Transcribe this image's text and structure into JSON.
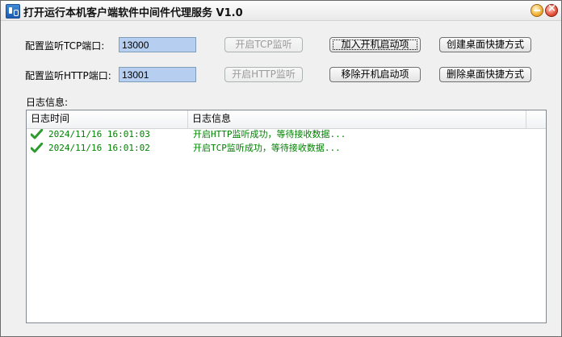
{
  "window": {
    "title": "打开运行本机客户端软件中间件代理服务 V1.0"
  },
  "config": {
    "tcp_label": "配置监听TCP端口:",
    "tcp_port": "13000",
    "http_label": "配置监听HTTP端口:",
    "http_port": "13001"
  },
  "buttons": {
    "start_tcp": "开启TCP监听",
    "start_http": "开启HTTP监听",
    "add_startup": "加入开机启动项",
    "remove_startup": "移除开机启动项",
    "create_shortcut": "创建桌面快捷方式",
    "delete_shortcut": "删除桌面快捷方式"
  },
  "log": {
    "section_label": "日志信息:",
    "columns": [
      "日志时间",
      "日志信息"
    ],
    "rows": [
      {
        "time": "2024/11/16 16:01:03",
        "message": "开启HTTP监听成功，等待接收数据...",
        "icon": "check-icon",
        "color": "#008000"
      },
      {
        "time": "2024/11/16 16:01:02",
        "message": "开启TCP监听成功，等待接收数据...",
        "icon": "check-icon",
        "color": "#008000"
      }
    ]
  }
}
